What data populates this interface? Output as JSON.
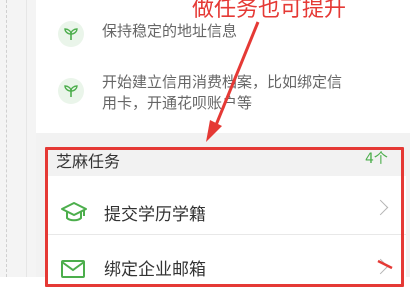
{
  "annotation": "做任务也可提升",
  "tips": [
    {
      "icon": "sprout-icon",
      "text_lines": [
        "保持稳定的地址信息"
      ]
    },
    {
      "icon": "sprout-icon",
      "text_lines": [
        "开始建立信用消费档案，比如绑定信",
        "用卡，开通花呗账户等"
      ]
    }
  ],
  "section": {
    "title": "芝麻任务",
    "count": "4个"
  },
  "tasks": [
    {
      "icon": "graduation-cap-icon",
      "label": "提交学历学籍"
    },
    {
      "icon": "mail-icon",
      "label": "绑定企业邮箱"
    }
  ],
  "colors": {
    "accent_green": "#4cae4c",
    "annotation_red": "#e53935"
  }
}
